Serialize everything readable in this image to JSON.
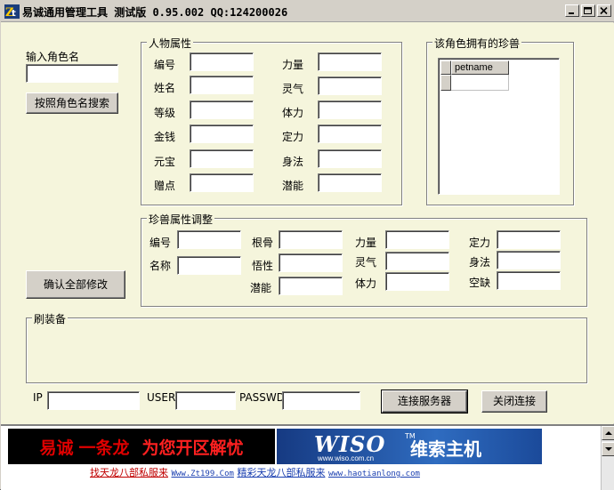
{
  "window": {
    "title": "易诚通用管理工具 测试版 0.95.002  QQ:124200026"
  },
  "search": {
    "label": "输入角色名",
    "value": "",
    "button": "按照角色名搜索"
  },
  "character": {
    "group_title": "人物属性",
    "fields_left": [
      {
        "label": "编号",
        "value": ""
      },
      {
        "label": "姓名",
        "value": ""
      },
      {
        "label": "等级",
        "value": ""
      },
      {
        "label": "金钱",
        "value": ""
      },
      {
        "label": "元宝",
        "value": ""
      },
      {
        "label": "赠点",
        "value": ""
      }
    ],
    "fields_right": [
      {
        "label": "力量",
        "value": ""
      },
      {
        "label": "灵气",
        "value": ""
      },
      {
        "label": "体力",
        "value": ""
      },
      {
        "label": "定力",
        "value": ""
      },
      {
        "label": "身法",
        "value": ""
      },
      {
        "label": "潜能",
        "value": ""
      }
    ]
  },
  "pets": {
    "group_title": "该角色拥有的珍兽",
    "column": "petname"
  },
  "pet_attrs": {
    "group_title": "珍兽属性调整",
    "col1": [
      {
        "label": "编号",
        "value": ""
      },
      {
        "label": "名称",
        "value": ""
      }
    ],
    "col2": [
      {
        "label": "根骨",
        "value": ""
      },
      {
        "label": "悟性",
        "value": ""
      },
      {
        "label": "潜能",
        "value": ""
      }
    ],
    "col3": [
      {
        "label": "力量",
        "value": ""
      },
      {
        "label": "灵气",
        "value": ""
      },
      {
        "label": "体力",
        "value": ""
      }
    ],
    "col4": [
      {
        "label": "定力",
        "value": ""
      },
      {
        "label": "身法",
        "value": ""
      },
      {
        "label": "空缺",
        "value": ""
      }
    ]
  },
  "confirm_button": "确认全部修改",
  "equipment": {
    "group_title": "刷装备"
  },
  "connection": {
    "ip_label": "IP",
    "user_label": "USER",
    "pass_label": "PASSWD",
    "ip": "",
    "user": "",
    "pass": "",
    "connect_button": "连接服务器",
    "disconnect_button": "关闭连接"
  },
  "ad": {
    "left_part1": "易诚",
    "left_part2": "一条龙",
    "left_part3": "为您开区解忧",
    "wiso_logo": "WISO",
    "wiso_tm": "TM",
    "wiso_url": "www.wiso.com.cn",
    "wiso_cn": "维索主机",
    "link1_text": "找天龙八部私服来",
    "link1_url": "Www.Zt199.Com",
    "link2_text": "精彩天龙八部私服来",
    "link2_url": "www.haotianlong.com"
  },
  "colors": {
    "bg": "#f5f5dc",
    "ad_red": "#e00000",
    "ad_yellow": "#ffd800",
    "link_blue": "#1a3fb0"
  }
}
